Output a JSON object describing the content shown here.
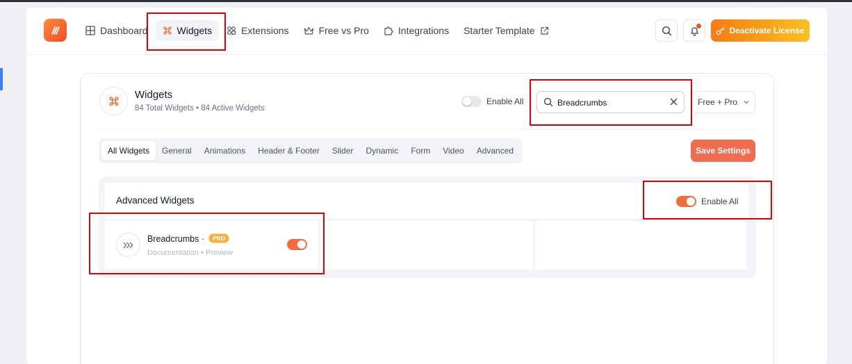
{
  "nav": {
    "items": [
      {
        "label": "Dashboard",
        "icon": "grid-icon",
        "active": false
      },
      {
        "label": "Widgets",
        "icon": "command-icon",
        "active": true
      },
      {
        "label": "Extensions",
        "icon": "extensions-icon",
        "active": false
      },
      {
        "label": "Free vs Pro",
        "icon": "crown-icon",
        "active": false
      },
      {
        "label": "Integrations",
        "icon": "puzzle-icon",
        "active": false
      },
      {
        "label": "Starter Template",
        "icon": "external-link-icon",
        "active": false
      }
    ],
    "deactivate_label": "Deactivate License"
  },
  "widgets": {
    "title": "Widgets",
    "subtitle": "84 Total Widgets • 84 Active Widgets",
    "enable_all_label": "Enable All",
    "search_value": "Breadcrumbs",
    "filter_label": "Free + Pro",
    "tabs": [
      "All Widgets",
      "General",
      "Animations",
      "Header & Footer",
      "Slider",
      "Dynamic",
      "Form",
      "Video",
      "Advanced"
    ],
    "active_tab": "All Widgets",
    "save_label": "Save Settings"
  },
  "advanced": {
    "title": "Advanced Widgets",
    "enable_all_label": "Enable All",
    "card": {
      "name": "Breadcrumbs",
      "separator": "·",
      "badge": "PRO",
      "link_doc": "Documentation",
      "link_sep": "•",
      "link_preview": "Preview",
      "enabled": true
    }
  },
  "colors": {
    "accent": "#f26d3d",
    "highlight": "#e10000",
    "license_gradient_start": "#f57c13",
    "license_gradient_end": "#fbbf24"
  }
}
